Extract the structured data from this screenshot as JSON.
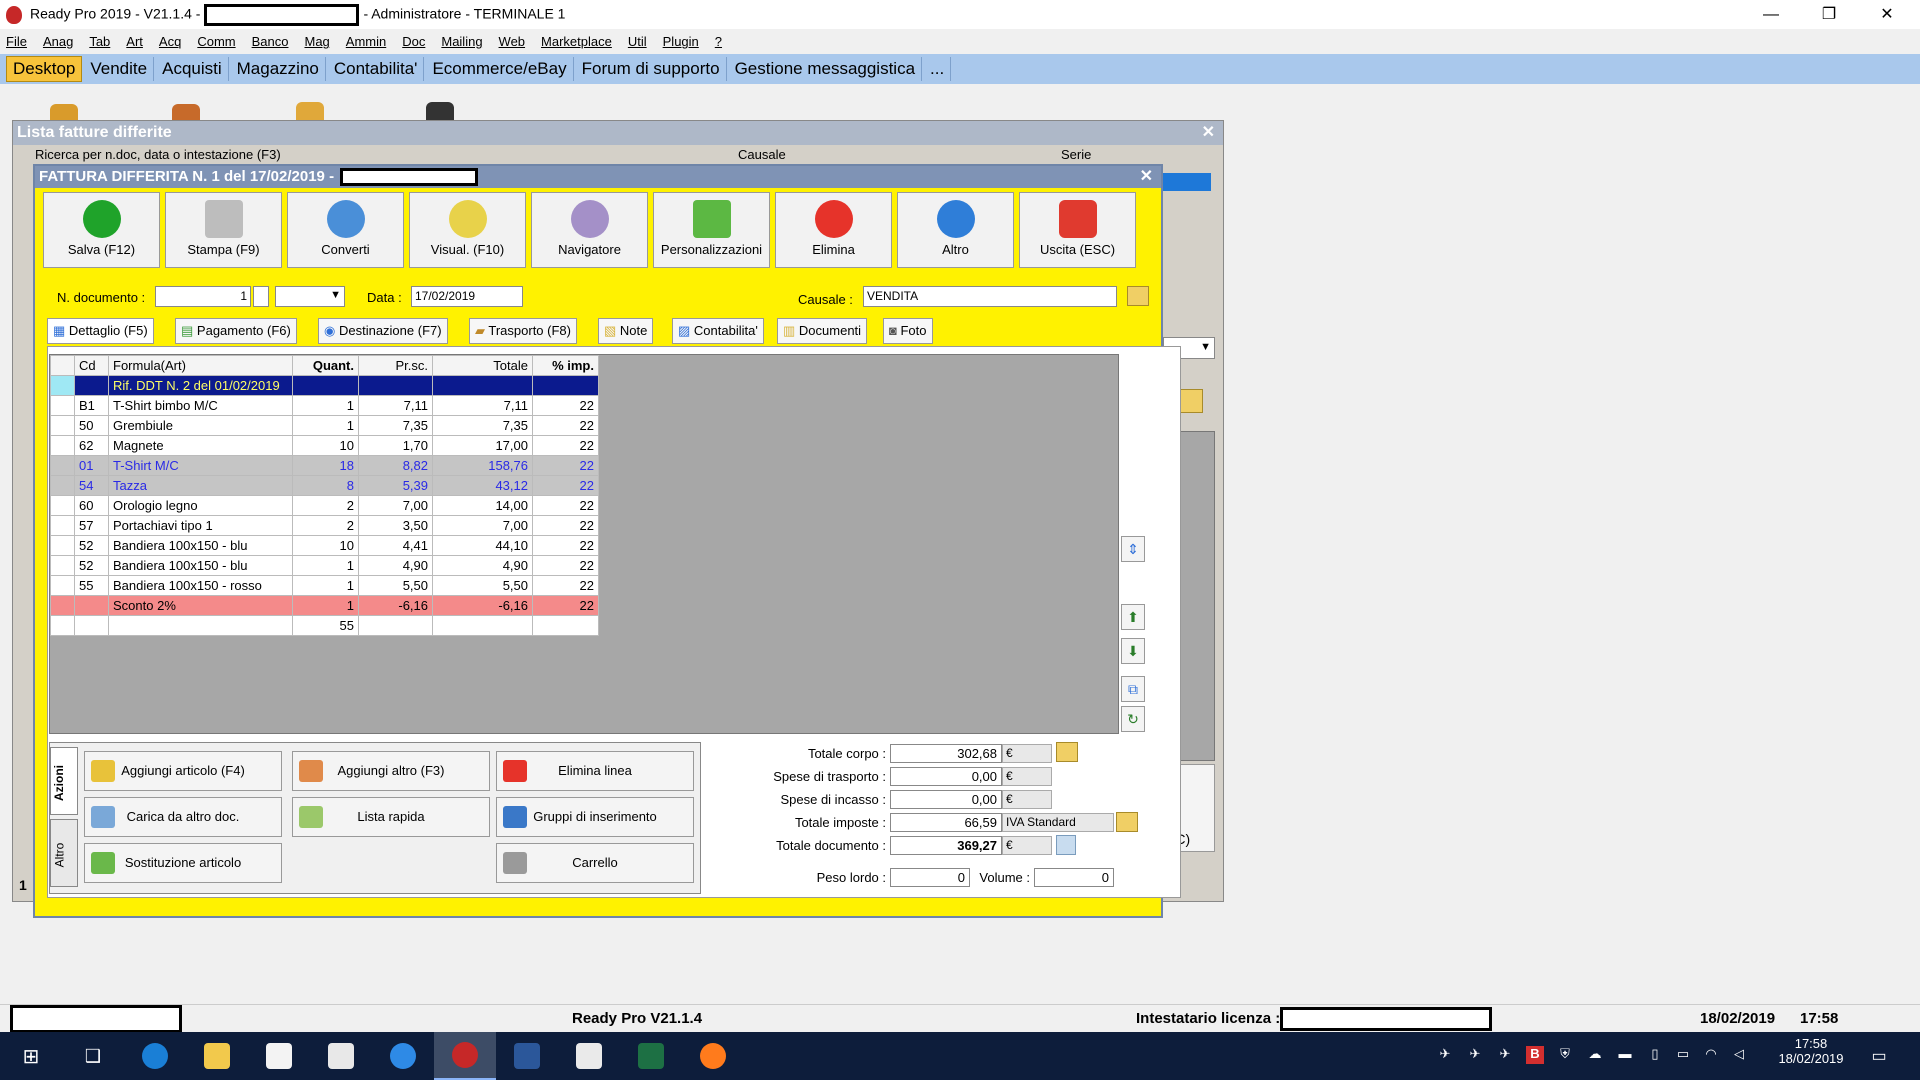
{
  "window": {
    "title_prefix": "Ready Pro 2019 - V21.1.4 -",
    "title_suffix": "- Administratore - TERMINALE 1",
    "minimize": "—",
    "restore": "❐",
    "close": "✕"
  },
  "menu": [
    "File",
    "Anag",
    "Tab",
    "Art",
    "Acq",
    "Comm",
    "Banco",
    "Mag",
    "Ammin",
    "Doc",
    "Mailing",
    "Web",
    "Marketplace",
    "Util",
    "Plugin",
    "?"
  ],
  "tabs": [
    "Desktop",
    "Vendite",
    "Acquisti",
    "Magazzino",
    "Contabilita'",
    "Ecommerce/eBay",
    "Forum di supporto",
    "Gestione messaggistica",
    "..."
  ],
  "outer": {
    "title": "Lista fatture differite",
    "search_label": "Ricerca per n.doc, data o intestazione (F3)",
    "causale_label": "Causale",
    "serie_label": "Serie",
    "right_frag": "SC)",
    "page_num": "1"
  },
  "dialog": {
    "title": "FATTURA DIFFERITA N. 1 del 17/02/2019 -",
    "toolbar": [
      "Salva (F12)",
      "Stampa (F9)",
      "Converti",
      "Visual. (F10)",
      "Navigatore",
      "Personalizzazioni",
      "Elimina",
      "Altro",
      "Uscita (ESC)"
    ],
    "ndoc_label": "N. documento :",
    "ndoc_value": "1",
    "data_label": "Data :",
    "data_value": "17/02/2019",
    "causale_label": "Causale :",
    "causale_value": "VENDITA",
    "subtabs": [
      "Dettaglio (F5)",
      "Pagamento (F6)",
      "Destinazione (F7)",
      "Trasporto (F8)",
      "Note",
      "Contabilita'",
      "Documenti",
      "Foto"
    ]
  },
  "grid": {
    "headers": [
      "Cd",
      "Formula(Art)",
      "Quant.",
      "Pr.sc.",
      "Totale",
      "% imp."
    ],
    "rows": [
      {
        "cd": "",
        "art": "Rif. DDT N. 2 del 01/02/2019",
        "q": "",
        "pr": "",
        "tot": "",
        "imp": "",
        "style": "hl"
      },
      {
        "cd": "B1",
        "art": "T-Shirt bimbo M/C",
        "q": "1",
        "pr": "7,11",
        "tot": "7,11",
        "imp": "22",
        "style": ""
      },
      {
        "cd": "50",
        "art": "Grembiule",
        "q": "1",
        "pr": "7,35",
        "tot": "7,35",
        "imp": "22",
        "style": ""
      },
      {
        "cd": "62",
        "art": "Magnete",
        "q": "10",
        "pr": "1,70",
        "tot": "17,00",
        "imp": "22",
        "style": ""
      },
      {
        "cd": "01",
        "art": "T-Shirt M/C",
        "q": "18",
        "pr": "8,82",
        "tot": "158,76",
        "imp": "22",
        "style": "sel"
      },
      {
        "cd": "54",
        "art": "Tazza",
        "q": "8",
        "pr": "5,39",
        "tot": "43,12",
        "imp": "22",
        "style": "sel"
      },
      {
        "cd": "60",
        "art": "Orologio legno",
        "q": "2",
        "pr": "7,00",
        "tot": "14,00",
        "imp": "22",
        "style": ""
      },
      {
        "cd": "57",
        "art": "Portachiavi tipo 1",
        "q": "2",
        "pr": "3,50",
        "tot": "7,00",
        "imp": "22",
        "style": ""
      },
      {
        "cd": "52",
        "art": "Bandiera 100x150 - blu",
        "q": "10",
        "pr": "4,41",
        "tot": "44,10",
        "imp": "22",
        "style": ""
      },
      {
        "cd": "52",
        "art": "Bandiera 100x150 - blu",
        "q": "1",
        "pr": "4,90",
        "tot": "4,90",
        "imp": "22",
        "style": ""
      },
      {
        "cd": "55",
        "art": "Bandiera 100x150 - rosso",
        "q": "1",
        "pr": "5,50",
        "tot": "5,50",
        "imp": "22",
        "style": ""
      },
      {
        "cd": "",
        "art": "Sconto 2%",
        "q": "1",
        "pr": "-6,16",
        "tot": "-6,16",
        "imp": "22",
        "style": "sc"
      },
      {
        "cd": "",
        "art": "",
        "q": "55",
        "pr": "",
        "tot": "",
        "imp": "",
        "style": "sum"
      }
    ]
  },
  "actions": {
    "tab_azioni": "Azioni",
    "tab_altro": "Altro",
    "buttons": [
      "Aggiungi articolo (F4)",
      "Aggiungi altro (F3)",
      "Elimina linea",
      "Carica da altro doc.",
      "Lista rapida",
      "Gruppi di inserimento",
      "Sostituzione articolo",
      "Carrello"
    ]
  },
  "totals": {
    "corpo_label": "Totale corpo :",
    "corpo": "302,68",
    "corpo_cur": "€",
    "trasporto_label": "Spese di trasporto :",
    "trasporto": "0,00",
    "trasporto_cur": "€",
    "incasso_label": "Spese di incasso :",
    "incasso": "0,00",
    "incasso_cur": "€",
    "imposte_label": "Totale imposte :",
    "imposte": "66,59",
    "imposte_cur": "IVA Standard",
    "documento_label": "Totale documento :",
    "documento": "369,27",
    "documento_cur": "€",
    "peso_label": "Peso lordo :",
    "peso": "0",
    "volume_label": "Volume :",
    "volume": "0"
  },
  "status": {
    "version": "Ready Pro V21.1.4",
    "license_label": "Intestatario licenza :",
    "date": "18/02/2019",
    "time": "17:58"
  },
  "taskbar": {
    "clock_time": "17:58",
    "clock_date": "18/02/2019"
  }
}
